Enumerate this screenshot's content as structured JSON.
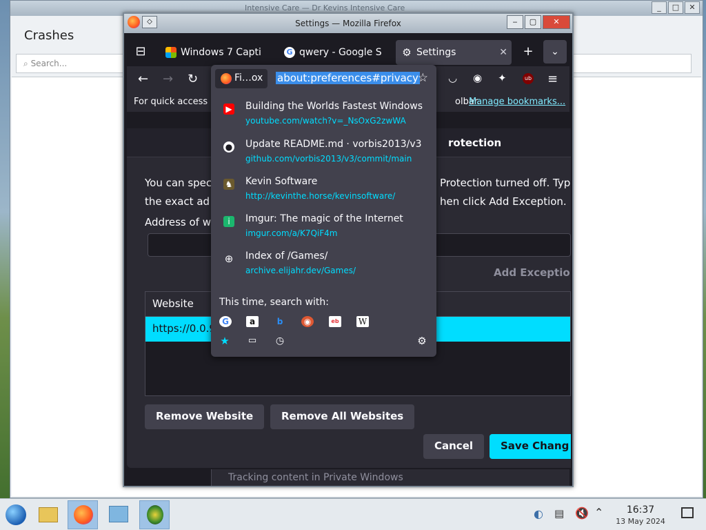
{
  "background_window": {
    "title": "Intensive Care — Dr Kevins Intensive Care",
    "heading": "Crashes",
    "search_placeholder": "Search..."
  },
  "firefox": {
    "window_title": "Settings — Mozilla Firefox",
    "tabs": [
      {
        "label": "Windows 7 Capti",
        "icon_color": "#f65314"
      },
      {
        "label": "qwery - Google S",
        "icon_color": "#4285f4"
      },
      {
        "label": "Settings",
        "icon_color": "#fbfbfe"
      }
    ],
    "bookmarks_bar": {
      "prefix": "For quick access",
      "suffix": "olbar.",
      "link": "Manage bookmarks..."
    },
    "dialog": {
      "title": "rotection",
      "line1_left": "You can spec",
      "line1_right": "Protection turned off. Typ",
      "line2_left": "the exact ad",
      "line2_right": "hen click Add Exception.",
      "address_label": "Address of w",
      "add_exception": "Add Exceptio",
      "table_header": "Website",
      "table_row": "https://0.0.9",
      "remove_website": "Remove Website",
      "remove_all": "Remove All Websites",
      "cancel": "Cancel",
      "save": "Save Chang"
    },
    "tracking_text": "Tracking content in Private Windows"
  },
  "urlbar_popup": {
    "identity_label": "Fi…ox",
    "url": "about:preferences#privacy",
    "results": [
      {
        "title": "Building the Worlds Fastest Windows",
        "url": "youtube.com/watch?v=_NsOxG2zwWA",
        "icon_color": "#ff0000"
      },
      {
        "title": "Update README.md · vorbis2013/v3",
        "url": "github.com/vorbis2013/v3/commit/main",
        "icon_color": "#fbfbfe"
      },
      {
        "title": "Kevin Software",
        "url": "http://kevinthe.horse/kevinsoftware/",
        "icon_color": "#8a7a4a"
      },
      {
        "title": "Imgur: The magic of the Internet",
        "url": "imgur.com/a/K7QiF4m",
        "icon_color": "#1bb76e"
      },
      {
        "title": "Index of /Games/",
        "url": "archive.elijahr.dev/Games/",
        "icon_color": "#fbfbfe"
      }
    ],
    "search_with": "This time, search with:"
  },
  "taskbar": {
    "time": "16:37",
    "date": "13 May 2024"
  },
  "colors": {
    "accent": "#00ddff",
    "firefox_bg": "#1c1b22",
    "panel": "#42414d"
  }
}
